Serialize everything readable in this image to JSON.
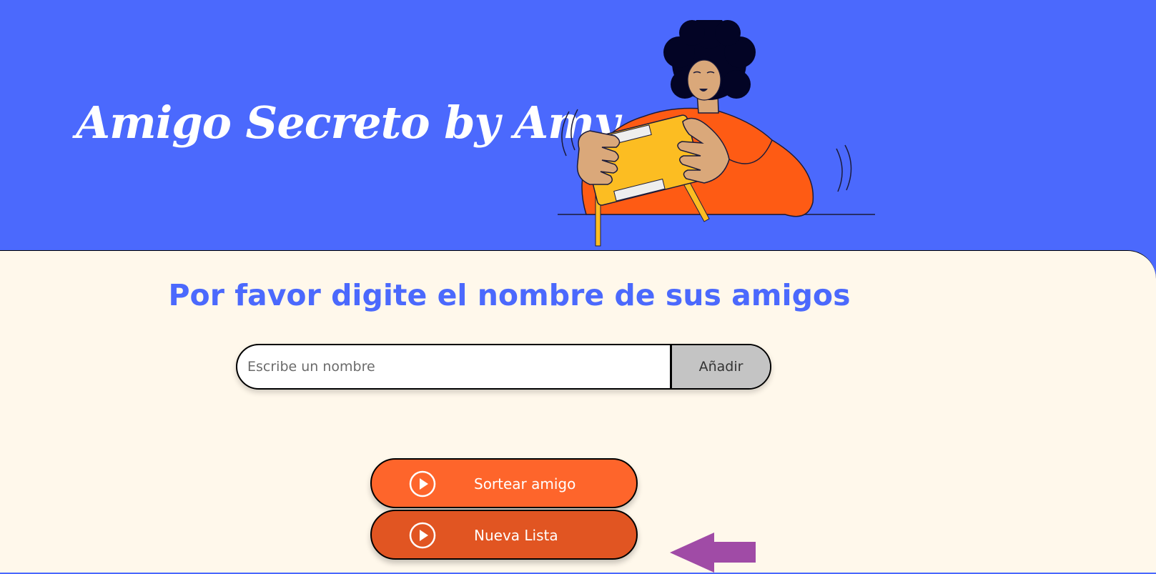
{
  "header": {
    "title": "Amigo Secreto by Amy",
    "illustration_icon": "person-holding-gift-illustration"
  },
  "main": {
    "section_title": "Por favor digite el nombre de sus amigos",
    "name_input": {
      "placeholder": "Escribe un nombre",
      "value": ""
    },
    "add_button_label": "Añadir",
    "draw_button": {
      "label": "Sortear amigo",
      "icon": "play-circle-icon"
    },
    "new_list_button": {
      "label": "Nueva Lista",
      "icon": "play-circle-icon"
    },
    "pointer_arrow_icon": "left-arrow-icon"
  },
  "colors": {
    "header_bg": "#4b69fd",
    "main_bg": "#fff8eb",
    "title_blue": "#4b69fd",
    "button_orange": "#fe652b",
    "button_orange_dark": "#e15522",
    "add_button_gray": "#c4c4c4",
    "arrow_purple": "#a04ba6"
  }
}
